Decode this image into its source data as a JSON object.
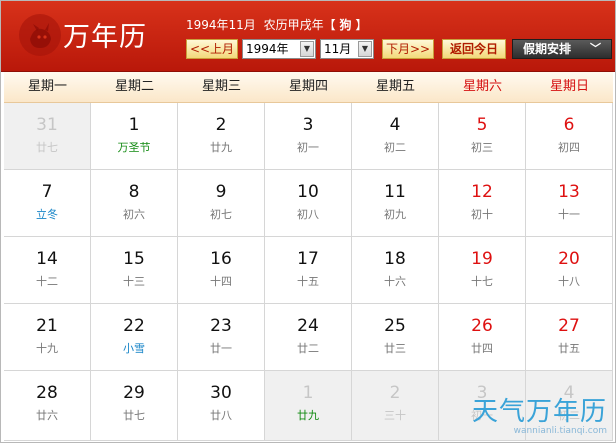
{
  "app": {
    "title": "万年历",
    "info": {
      "date_text": "1994年11月",
      "lunar_text": "农历甲戌年【",
      "zodiac": "狗",
      "bracket_close": "】"
    }
  },
  "controls": {
    "prev_month": "<<上月",
    "year_select": "1994年",
    "month_select": "11月",
    "next_month": "下月>>",
    "today": "返回今日",
    "holiday": "假期安排",
    "holiday_chevron": "﹀"
  },
  "colors": {
    "header_red": "#c8200e",
    "weekend_red": "#de1010",
    "festival_green": "#118a11",
    "solar_term_blue": "#1a86c8",
    "watermark_blue": "#3aa3d8"
  },
  "weekdays": [
    "星期一",
    "星期二",
    "星期三",
    "星期四",
    "星期五",
    "星期六",
    "星期日"
  ],
  "weeks": [
    [
      {
        "day": "31",
        "lunar": "廿七",
        "other": true
      },
      {
        "day": "1",
        "lunar": "万圣节",
        "type": "festival"
      },
      {
        "day": "2",
        "lunar": "廿九"
      },
      {
        "day": "3",
        "lunar": "初一"
      },
      {
        "day": "4",
        "lunar": "初二"
      },
      {
        "day": "5",
        "lunar": "初三"
      },
      {
        "day": "6",
        "lunar": "初四"
      }
    ],
    [
      {
        "day": "7",
        "lunar": "立冬",
        "type": "term"
      },
      {
        "day": "8",
        "lunar": "初六"
      },
      {
        "day": "9",
        "lunar": "初七"
      },
      {
        "day": "10",
        "lunar": "初八"
      },
      {
        "day": "11",
        "lunar": "初九"
      },
      {
        "day": "12",
        "lunar": "初十"
      },
      {
        "day": "13",
        "lunar": "十一"
      }
    ],
    [
      {
        "day": "14",
        "lunar": "十二"
      },
      {
        "day": "15",
        "lunar": "十三"
      },
      {
        "day": "16",
        "lunar": "十四"
      },
      {
        "day": "17",
        "lunar": "十五"
      },
      {
        "day": "18",
        "lunar": "十六"
      },
      {
        "day": "19",
        "lunar": "十七"
      },
      {
        "day": "20",
        "lunar": "十八"
      }
    ],
    [
      {
        "day": "21",
        "lunar": "十九"
      },
      {
        "day": "22",
        "lunar": "小雪",
        "type": "term"
      },
      {
        "day": "23",
        "lunar": "廿一"
      },
      {
        "day": "24",
        "lunar": "廿二"
      },
      {
        "day": "25",
        "lunar": "廿三"
      },
      {
        "day": "26",
        "lunar": "廿四"
      },
      {
        "day": "27",
        "lunar": "廿五"
      }
    ],
    [
      {
        "day": "28",
        "lunar": "廿六"
      },
      {
        "day": "29",
        "lunar": "廿七"
      },
      {
        "day": "30",
        "lunar": "廿八"
      },
      {
        "day": "1",
        "lunar": "廿九",
        "other": true,
        "type": "festival"
      },
      {
        "day": "2",
        "lunar": "三十",
        "other": true
      },
      {
        "day": "3",
        "lunar": "初一",
        "other": true
      },
      {
        "day": "4",
        "lunar": "初二",
        "other": true
      }
    ]
  ],
  "watermark": {
    "brand": "天气万年历",
    "url": "wannianli.tianqi.com"
  }
}
